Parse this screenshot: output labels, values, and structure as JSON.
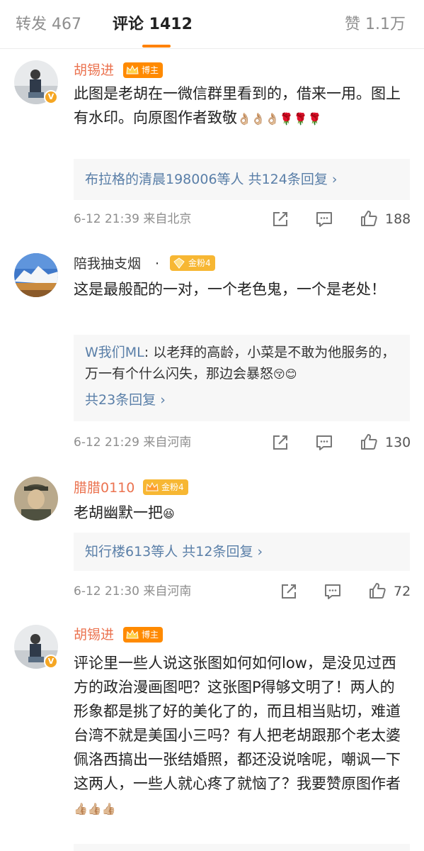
{
  "tabs": {
    "repost": "转发 467",
    "comments": "评论 1412",
    "likes": "赞 1.1万"
  },
  "comments": [
    {
      "name": "胡锡进",
      "badge": "博主",
      "text": "此图是老胡在一微信群里看到的，借来一用。图上有水印。向原图作者致敬",
      "emojis": "👌🏼👌🏼👌🏼🌹🌹🌹",
      "replies": "布拉格的清晨198006等人  共124条回复 ›",
      "time": "6-12 21:39",
      "location": "来自北京",
      "likes": "188"
    },
    {
      "name": "陪我抽支烟",
      "badge": "金粉4",
      "text": "这是最般配的一对，一个老色鬼，一个是老处！",
      "quote_user": "W我们ML",
      "quote_text": ": 以老拜的高龄，小菜是不敢为他服务的，万一有个什么闪失，那边会暴怒",
      "quote_emojis": "😚😊",
      "replies": "共23条回复 ›",
      "time": "6-12 21:29",
      "location": "来自河南",
      "likes": "130"
    },
    {
      "name": "腊腊0110",
      "badge": "金粉4",
      "text": "老胡幽默一把",
      "emojis": "😆",
      "replies": "知行楼613等人  共12条回复 ›",
      "time": "6-12 21:30",
      "location": "来自河南",
      "likes": "72"
    },
    {
      "name": "胡锡进",
      "badge": "博主",
      "text": "评论里一些人说这张图如何如何low，是没见过西方的政治漫画图吧？这张图P得够文明了！两人的形象都是挑了好的美化了的，而且相当贴切，难道台湾不就是美国小三吗？有人把老胡跟那个老太婆佩洛西搞出一张结婚照，都还没说啥呢，嘲讽一下这两人，一些人就心疼了就恼了？我要赞原图作者",
      "emojis": "👍🏼👍🏼👍🏼"
    }
  ],
  "colors": {
    "accent": "#ff8200",
    "link": "#5a7fa8",
    "name_orange": "#eb7350",
    "muted": "#8e8e8e"
  },
  "icons": [
    "share-icon",
    "comment-icon",
    "like-icon",
    "crown-icon",
    "verified-icon"
  ]
}
